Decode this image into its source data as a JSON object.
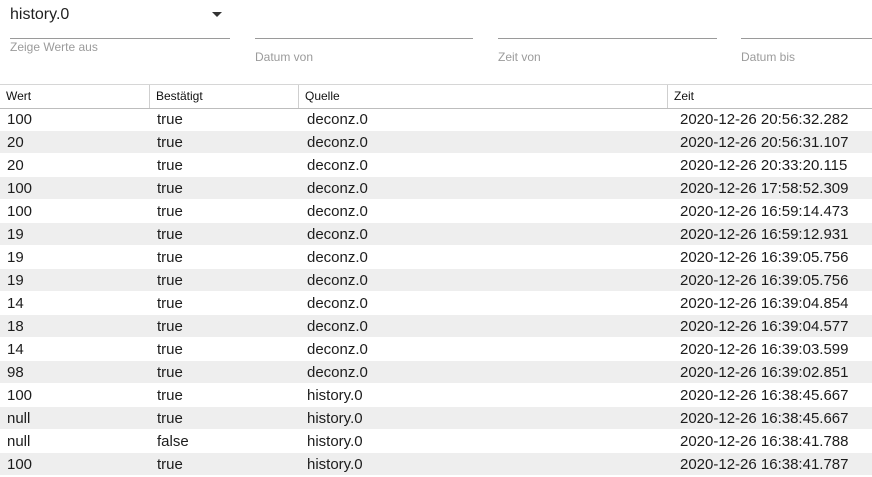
{
  "filters": {
    "instance": {
      "value": "history.0",
      "label": "Zeige Werte aus"
    },
    "date_from_label": "Datum von",
    "time_from_label": "Zeit von",
    "date_to_label": "Datum bis"
  },
  "table": {
    "columns": [
      "Wert",
      "Bestätigt",
      "Quelle",
      "Zeit"
    ],
    "rows": [
      [
        "100",
        "true",
        "deconz.0",
        "2020-12-26 20:56:32.282"
      ],
      [
        "20",
        "true",
        "deconz.0",
        "2020-12-26 20:56:31.107"
      ],
      [
        "20",
        "true",
        "deconz.0",
        "2020-12-26 20:33:20.115"
      ],
      [
        "100",
        "true",
        "deconz.0",
        "2020-12-26 17:58:52.309"
      ],
      [
        "100",
        "true",
        "deconz.0",
        "2020-12-26 16:59:14.473"
      ],
      [
        "19",
        "true",
        "deconz.0",
        "2020-12-26 16:59:12.931"
      ],
      [
        "19",
        "true",
        "deconz.0",
        "2020-12-26 16:39:05.756"
      ],
      [
        "19",
        "true",
        "deconz.0",
        "2020-12-26 16:39:05.756"
      ],
      [
        "14",
        "true",
        "deconz.0",
        "2020-12-26 16:39:04.854"
      ],
      [
        "18",
        "true",
        "deconz.0",
        "2020-12-26 16:39:04.577"
      ],
      [
        "14",
        "true",
        "deconz.0",
        "2020-12-26 16:39:03.599"
      ],
      [
        "98",
        "true",
        "deconz.0",
        "2020-12-26 16:39:02.851"
      ],
      [
        "100",
        "true",
        "history.0",
        "2020-12-26 16:38:45.667"
      ],
      [
        "null",
        "true",
        "history.0",
        "2020-12-26 16:38:45.667"
      ],
      [
        "null",
        "false",
        "history.0",
        "2020-12-26 16:38:41.788"
      ],
      [
        "100",
        "true",
        "history.0",
        "2020-12-26 16:38:41.787"
      ]
    ]
  }
}
